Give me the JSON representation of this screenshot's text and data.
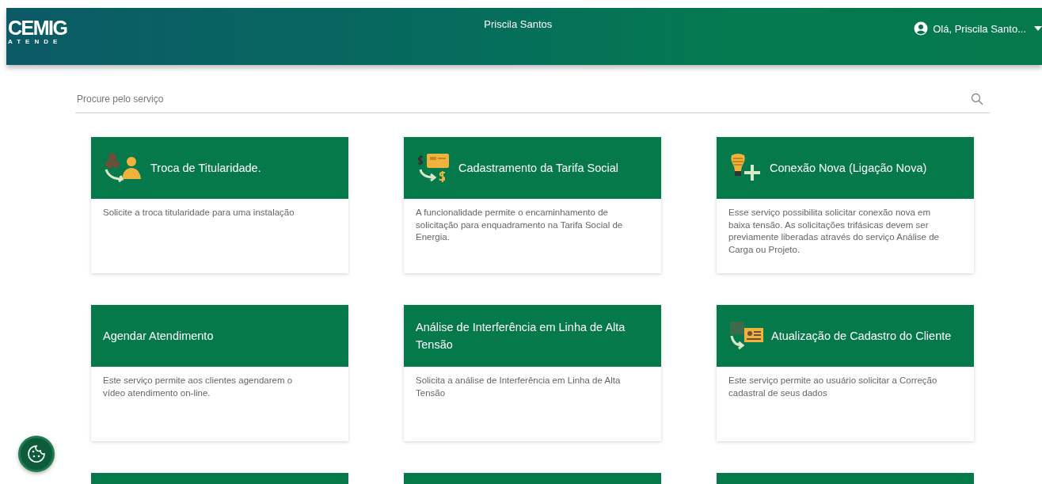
{
  "header": {
    "logo": "CEMIG",
    "logo_subtitle": "ATENDE",
    "user_name": "Priscila Santos",
    "greeting": "Olá, Priscila Santo..."
  },
  "search": {
    "placeholder": "Procure pelo serviço"
  },
  "services": [
    {
      "title": "Troca de Titularidade.",
      "description": "Solicite a troca titularidade para uma instalação",
      "kind": "people"
    },
    {
      "title": "Cadastramento da Tarifa Social",
      "description": "A funcionalidade permite o encaminhamento de solicitação para enquadramento na Tarifa Social de Energia.",
      "kind": "card-money"
    },
    {
      "title": "Conexão Nova (Ligação Nova)",
      "description": "Esse serviço possibilita solicitar conexão nova em baixa tensão. As solicitações trifásicas devem ser previamente liberadas através do serviço Análise de Carga ou Projeto.",
      "kind": "bulb-plus"
    },
    {
      "title": "Agendar Atendimento",
      "description": "Este serviço permite aos clientes agendarem o vídeo atendimento on-line."
    },
    {
      "title": "Análise de Interferência em Linha de Alta Tensão",
      "description": "Solicita a análise de Interferência em Linha de Alta Tensão"
    },
    {
      "title": "Atualização de Cadastro do Cliente",
      "description": "Este serviço permite ao usuário solicitar a Correção cadastral de seus dados",
      "kind": "id-card"
    },
    {
      "kind": "cut"
    },
    {
      "kind": "cut"
    },
    {
      "kind": "cut"
    }
  ],
  "cookie_button": {
    "kind": "cookie"
  }
}
